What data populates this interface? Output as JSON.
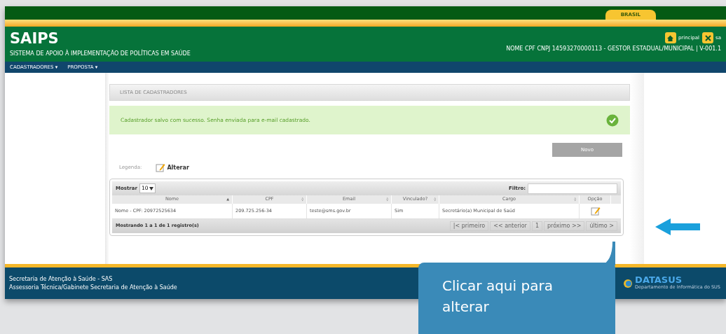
{
  "top_bar": {
    "badge": "BRASIL"
  },
  "header": {
    "title": "SAIPS",
    "subtitle": "SISTEMA DE APOIO À IMPLEMENTAÇÃO DE POLÍTICAS EM SAÚDE",
    "links": [
      {
        "kind": "home",
        "label": "principal"
      },
      {
        "kind": "exit",
        "label": "sa"
      }
    ],
    "user_info": "NOME CPF CNPJ 14593270000113 - GESTOR ESTADUAL/MUNICIPAL | V-001.1"
  },
  "nav": [
    {
      "label": "CADASTRADORES",
      "caret": "▾"
    },
    {
      "label": "PROPOSTA",
      "caret": "▾"
    }
  ],
  "panel": {
    "title": "LISTA DE CADASTRADORES",
    "message": "Cadastrador salvo com sucesso. Senha enviada para e-mail cadastrado.",
    "new_button": "Novo",
    "legend_label": "Legenda:",
    "legend_item": "Alterar"
  },
  "table": {
    "show_label": "Mostrar",
    "page_size": "10",
    "filter_label": "Filtro:",
    "columns": [
      {
        "label": "Nome",
        "sort": "▲"
      },
      {
        "label": "CPF",
        "sort": "◊"
      },
      {
        "label": "Email",
        "sort": "◊"
      },
      {
        "label": "Vinculado?",
        "sort": "◊"
      },
      {
        "label": "Cargo",
        "sort": "◊"
      },
      {
        "label": "Opção"
      }
    ],
    "rows": [
      {
        "cells": [
          "Nome - CPF: 20972525634",
          "209.725.256-34",
          "teste@sms.gov.br",
          "Sim",
          "Secretário(a) Municipal de Saúd"
        ]
      }
    ],
    "info": "Mostrando 1 a 1 de 1 registro(s)",
    "pagination": [
      "|< primeiro",
      "<< anterior",
      "1",
      "próximo >>",
      "último >"
    ]
  },
  "footer": {
    "lines": [
      "Secretaria de Atenção à Saúde - SAS",
      "Assessoria Técnica/Gabinete Secretaria de Atenção à Saúde"
    ],
    "logo": "DATASUS",
    "logo_sub": "Departamento de Informática do SUS"
  },
  "callout": {
    "text": "Clicar aqui para alterar"
  }
}
